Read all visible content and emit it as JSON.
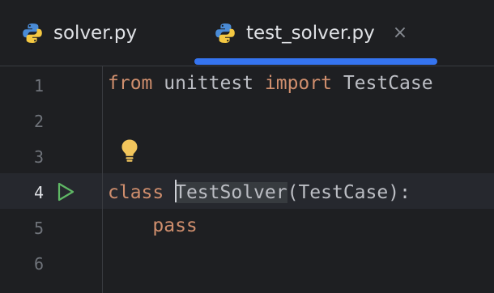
{
  "tabs": [
    {
      "label": "solver.py",
      "icon": "python-icon"
    },
    {
      "label": "test_solver.py",
      "icon": "python-icon",
      "active": true,
      "close_glyph": "×"
    }
  ],
  "gutter": {
    "line_numbers": [
      "1",
      "2",
      "3",
      "4",
      "5",
      "6"
    ],
    "current_line": "4"
  },
  "code": {
    "line1": {
      "kw1": "from",
      "mod": " unittest ",
      "kw2": "import",
      "name": " TestCase"
    },
    "line4": {
      "kw": "class",
      "sp": " ",
      "name": "TestSolver",
      "rest": "(TestCase):"
    },
    "line5": {
      "indent": "    ",
      "kw": "pass"
    }
  },
  "colors": {
    "background": "#1e1f22",
    "keyword": "#cf8e6d",
    "text": "#bcbec4",
    "accent": "#3574f0",
    "run": "#5fb865",
    "bulb": "#f2c55c"
  }
}
